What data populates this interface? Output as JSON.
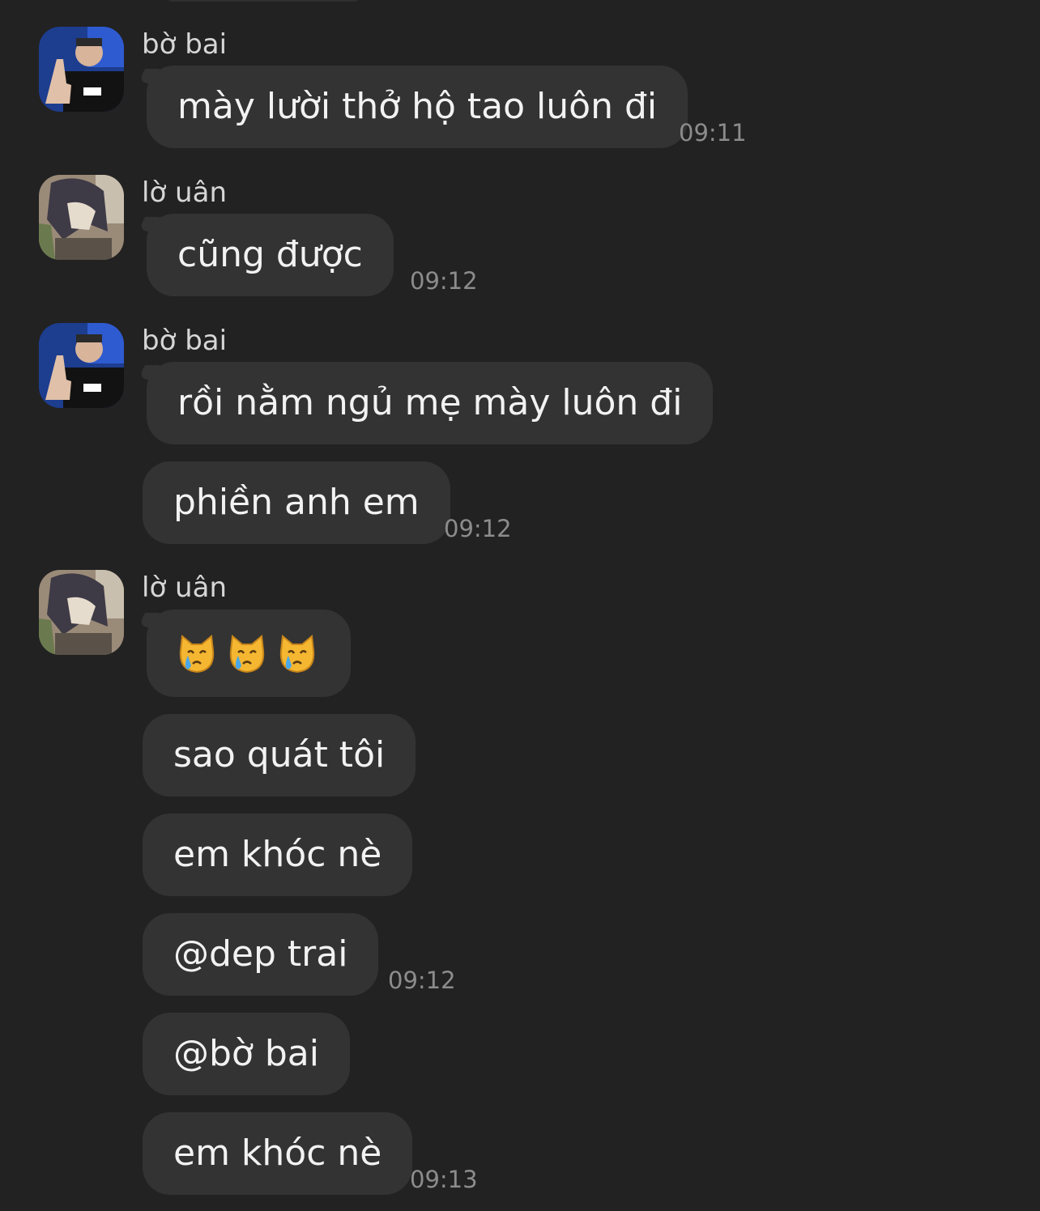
{
  "messages": [
    {
      "sender": "bờ bai",
      "text": "mày lười thở hộ tao luôn đi",
      "time": "09:11"
    },
    {
      "sender": "lờ uân",
      "text": "cũng được",
      "time": "09:12"
    },
    {
      "sender": "bờ bai",
      "text": "rồi nằm ngủ mẹ mày luôn đi"
    },
    {
      "text": "phiền anh em",
      "time": "09:12"
    },
    {
      "sender": "lờ uân",
      "emoji": [
        "crying-cat-face",
        "crying-cat-face",
        "crying-cat-face"
      ]
    },
    {
      "text": "sao quát tôi"
    },
    {
      "text": "em khóc nè"
    },
    {
      "text": "@dep trai",
      "time": "09:12"
    },
    {
      "text": "@bờ bai"
    },
    {
      "text": "em khóc nè",
      "time": "09:13"
    }
  ],
  "colors": {
    "background": "#222222",
    "bubble": "#333333",
    "text": "#f2f2f2",
    "sender": "#d6d6d6",
    "timestamp": "#8c8c8c"
  }
}
